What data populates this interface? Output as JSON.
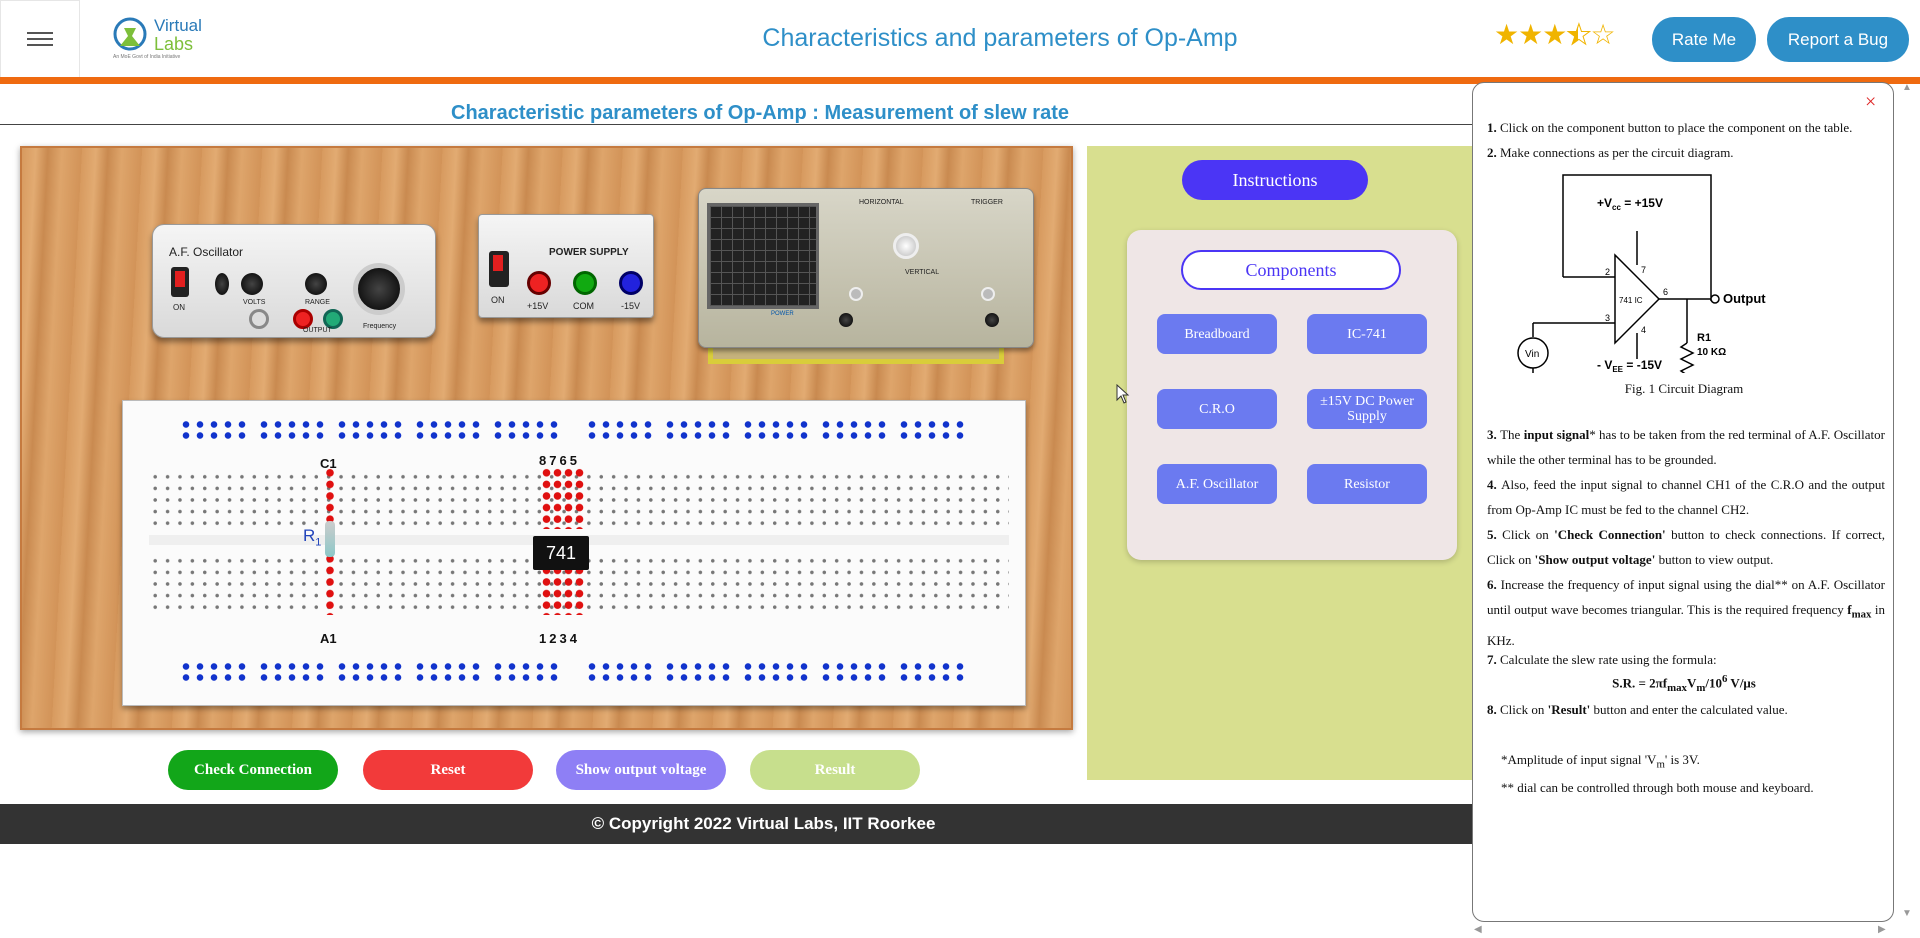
{
  "header": {
    "logo_top": "Virtual",
    "logo_bottom": "Labs",
    "logo_sub": "An MoE Govt of India Initiative",
    "title": "Characteristics and parameters of Op-Amp",
    "rating": 3.5,
    "rate_label": "Rate Me",
    "bug_label": "Report a Bug"
  },
  "subtitle": "Characteristic parameters of Op-Amp : Measurement of slew rate",
  "bench": {
    "oscillator": {
      "title": "A.F. Oscillator",
      "on": "ON",
      "volts": "VOLTS",
      "range": "RANGE",
      "output": "OUTPUT",
      "frequency": "Frequency"
    },
    "power_supply": {
      "title": "POWER SUPPLY",
      "on": "ON",
      "plus": "+15V",
      "com": "COM",
      "minus": "-15V"
    },
    "cro": {
      "horizontal": "HORIZONTAL",
      "vertical": "VERTICAL",
      "trigger": "TRIGGER",
      "power": "POWER"
    },
    "breadboard": {
      "chip": "741",
      "top_pins": "8765",
      "bottom_pins": "1234",
      "c1": "C1",
      "a1": "A1",
      "r1": "R",
      "r1_sub": "1"
    }
  },
  "actions": {
    "check": "Check Connection",
    "reset": "Reset",
    "show_output": "Show output voltage",
    "result": "Result"
  },
  "footer": "© Copyright 2022 Virtual Labs, IIT Roorkee",
  "panel": {
    "instructions": "Instructions",
    "components_title": "Components",
    "components": [
      "Breadboard",
      "IC-741",
      "C.R.O",
      "±15V DC Power Supply",
      "A.F. Oscillator",
      "Resistor"
    ]
  },
  "instructions": {
    "close": "×",
    "s1": "Click on the component button to place the component on the table.",
    "s2": "Make connections as per the circuit diagram.",
    "diagram": {
      "vcc": "+V",
      "vcc_sub": "cc",
      "vcc_val": " = +15V",
      "vee": "- V",
      "vee_sub": "EE",
      "vee_val": " = -15V",
      "ic": "741 IC",
      "output": "Output",
      "r1": "R1",
      "r1_val": "10 KΩ",
      "vin": "Vin",
      "pin7": "7",
      "pin6": "6",
      "pin2": "2",
      "pin3": "3",
      "pin4": "4"
    },
    "caption": "Fig. 1 Circuit Diagram",
    "s3a": "The ",
    "s3b": "input signal",
    "s3c": "* has to be taken from the red terminal of A.F. Oscillator while the other terminal has to be grounded.",
    "s4": "Also, feed the input signal to channel CH1 of the C.R.O and the output from Op-Amp IC must be fed to the channel CH2.",
    "s5a": "Click on ",
    "s5b": "'Check Connection'",
    "s5c": " button to check connections. If correct, Click on ",
    "s5d": "'Show output voltage'",
    "s5e": " button to view output.",
    "s6a": "Increase the frequency of input signal using the dial** on A.F. Oscillator until output wave becomes triangular. This is the required frequency ",
    "s6b": "f",
    "s6c": "max",
    "s6d": " in KHz.",
    "s7": "Calculate the slew rate using the formula:",
    "formula": "S.R. = 2πf",
    "formula_max": "max",
    "formula_v": "V",
    "formula_m": "m",
    "formula_rest": "/10",
    "formula_exp": "6",
    "formula_unit": "  V/μs",
    "s8a": "Click on ",
    "s8b": "'Result'",
    "s8c": " button and enter the calculated value.",
    "note1a": "*Amplitude of input signal 'V",
    "note1b": "m",
    "note1c": "' is 3V.",
    "note2": "** dial can be controlled through both mouse and keyboard."
  },
  "colors": {
    "accent": "#2e8fc8",
    "orange": "#ef6a10",
    "green": "#12a619",
    "red": "#f23a3a",
    "purple": "#8e7ff5",
    "lightgreen": "#c7df8d",
    "blue": "#4b35f5"
  }
}
